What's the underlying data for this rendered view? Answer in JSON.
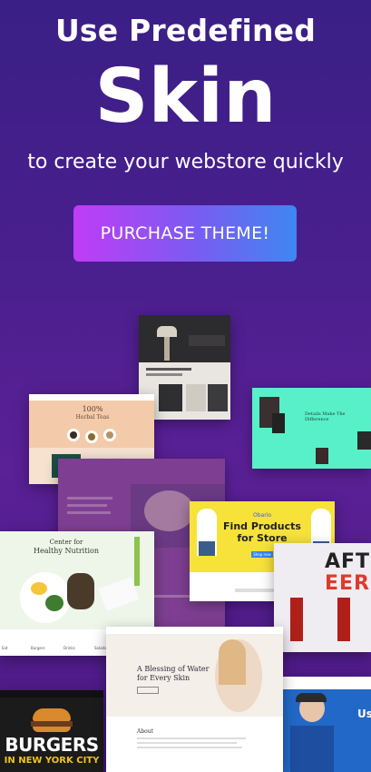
{
  "hero": {
    "title_line1": "Use Predefined",
    "title_line2": "Skin",
    "subtitle": "to create your webstore quickly",
    "cta_label": "PURCHASE THEME!"
  },
  "previews": {
    "tea": {
      "heading": "100%",
      "subheading": "Herbal Teas"
    },
    "mint": {
      "heading": "Details Make The Difference"
    },
    "store": {
      "brand": "Obario",
      "heading_line1": "Find Products",
      "heading_line2": "for Store",
      "button": "Shop now"
    },
    "nutrition": {
      "heading_line1": "Center for",
      "heading_line2": "Healthy Nutrition",
      "tabs": [
        "Eat",
        "Burgers",
        "Drinks",
        "Salads"
      ]
    },
    "beauty": {
      "heading_line1": "A Blessing of Water",
      "heading_line2": "for Every Skin",
      "about": "About"
    },
    "craft": {
      "text_line1": "AFT",
      "text_line2": "EER"
    },
    "burgers": {
      "title": "BURGERS",
      "subtitle": "IN NEW YORK CITY"
    },
    "fashion": {
      "text": "Use"
    }
  },
  "colors": {
    "cta_start": "#c03cf6",
    "cta_end": "#3f86f1",
    "background": "#4a1f8e"
  }
}
